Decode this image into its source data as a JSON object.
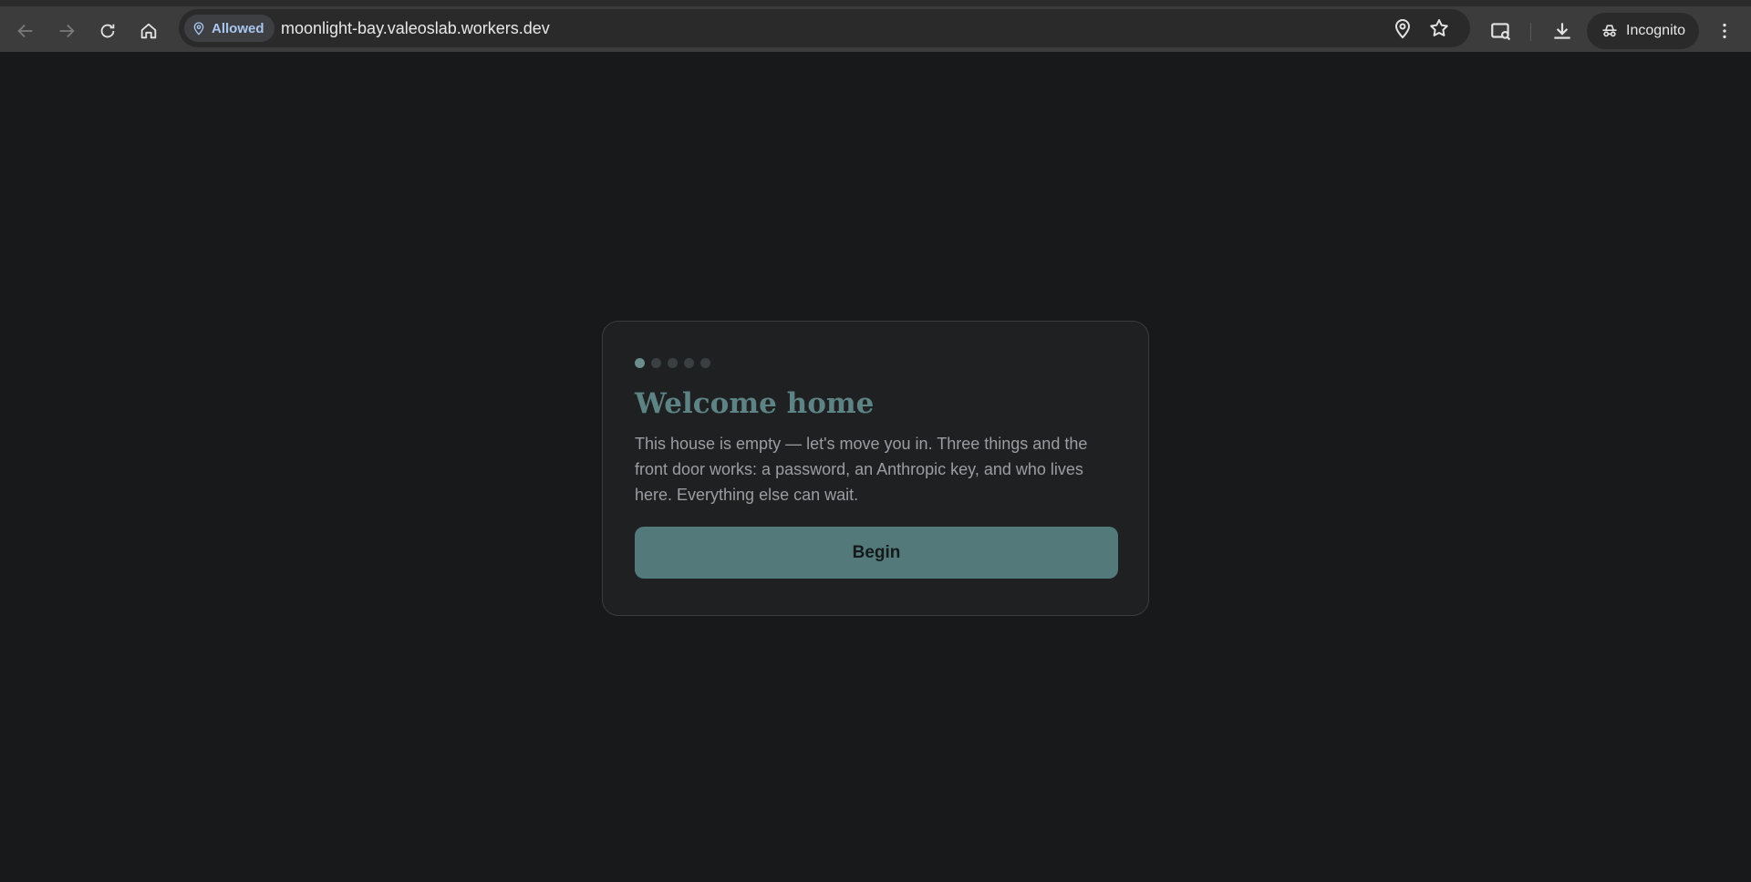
{
  "browser": {
    "site_chip_label": "Allowed",
    "url": "moonlight-bay.valeoslab.workers.dev",
    "incognito_label": "Incognito"
  },
  "onboarding": {
    "steps_total": 5,
    "active_step": 1,
    "title": "Welcome home",
    "body": "This house is empty — let's move you in. Three things and the front door works: a password, an Anthropic key, and who lives here. Everything else can wait.",
    "begin_label": "Begin"
  },
  "colors": {
    "page_background": "#18191b",
    "card_background": "#1f2022",
    "accent": "#54797b",
    "title": "#5e8385"
  }
}
